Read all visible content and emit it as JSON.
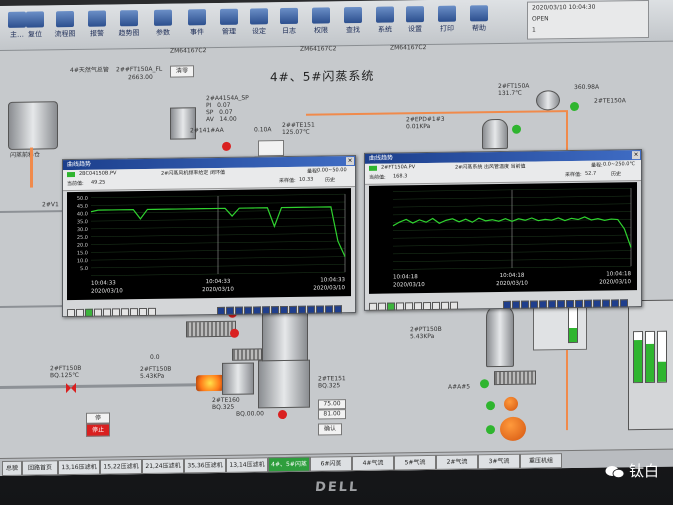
{
  "toolbar": {
    "buttons": [
      "主…",
      "复位",
      "流程图",
      "报警",
      "趋势图",
      "参数",
      "事件",
      "管理",
      "设定",
      "日志",
      "权限",
      "查找",
      "系统",
      "设置",
      "打印",
      "帮助"
    ],
    "status_time": "2020/03/10 10:04:30",
    "status_label": "OPEN",
    "status_line2": "1",
    "sub_tags": [
      "ZM64167C2",
      "ZM64167C2",
      "ZM64167C2"
    ]
  },
  "screen": {
    "title": "4#、5#闪蒸系统",
    "gas_label": "4#天然气总管",
    "gas_tag": "2##FT150A_FL",
    "gas_value": "2663.00",
    "clear_button": "清零",
    "silo_label": "闪蒸前料仓",
    "tag_blocks": [
      {
        "t": "2#A4154A_SP\nPI   0.07\nSP   0.07\nAV   14.00"
      },
      {
        "t": "2#141#AA"
      },
      {
        "t": "0.10A"
      },
      {
        "t": "2##TE151\n125.07℃"
      },
      {
        "t": "2#EPD#1#3\n0.01KPa"
      },
      {
        "t": "2#FT150A\n131.7℃"
      },
      {
        "t": "360.98A"
      },
      {
        "t": "2#TE150A"
      },
      {
        "t": "2#PT150B\n5.43KPa"
      },
      {
        "t": "2#TE151\nBQ.325"
      },
      {
        "t": "2#FT150B\nBQ.125℃"
      },
      {
        "t": "2#FT150B\n5.43KPa"
      },
      {
        "t": "2#TE160\nBQ.325"
      },
      {
        "t": "BQ.00.00"
      },
      {
        "t": "75.00"
      },
      {
        "t": "81.00"
      },
      {
        "t": "0.0"
      },
      {
        "t": "2#V1"
      },
      {
        "t": "A#A#5"
      }
    ],
    "confirm_button": "确认",
    "left_boxes": [
      "停",
      "停止"
    ]
  },
  "trend1": {
    "title": "曲线趋势",
    "tag": "2BC04150B.PV",
    "desc": "2#闪蒸风机频率给定 闭环值",
    "range_label": "量程:",
    "range": "0.00~50.00",
    "cursor_label": "当前值:",
    "cursor": "49.25",
    "period_label": "采样值:",
    "period": "10.33",
    "mode": "历史",
    "times": [
      "10:04:33",
      "10:04:33",
      "10:04:33"
    ],
    "dates": [
      "2020/03/10",
      "2020/03/10",
      "2020/03/10"
    ],
    "ticks": [
      "50.0",
      "45.0",
      "40.0",
      "35.0",
      "30.0",
      "25.0",
      "20.0",
      "15.0",
      "10.0",
      "5.0"
    ]
  },
  "trend2": {
    "title": "曲线趋势",
    "tag": "2#FT150A.PV",
    "desc": "2#闪蒸系统 出风管温度 当前值",
    "range_label": "量程:",
    "range": "0.0~250.0℃",
    "cursor_label": "当前值:",
    "cursor": "168.3",
    "period_label": "采样值:",
    "period": "52.7",
    "mode": "历史",
    "times": [
      "10:04:18",
      "10:04:18",
      "10:04:18"
    ],
    "dates": [
      "2020/03/10",
      "2020/03/10",
      "2020/03/10"
    ]
  },
  "chart_data": [
    {
      "type": "line",
      "series": [
        {
          "values": [
            41,
            42,
            42,
            42,
            42,
            42,
            42,
            36,
            42,
            42,
            42,
            42,
            42,
            42,
            42,
            42,
            42,
            42,
            42,
            42,
            37,
            42,
            42,
            42,
            42,
            42,
            30,
            42,
            42,
            42,
            42,
            42,
            42,
            42,
            42,
            20,
            10
          ]
        }
      ],
      "ylim": [
        0,
        50
      ]
    },
    {
      "type": "line",
      "series": [
        {
          "values": [
            140,
            152,
            160,
            148,
            158,
            150,
            162,
            146,
            155,
            160,
            150,
            158,
            148,
            161,
            152,
            155,
            150,
            158,
            149,
            157,
            152,
            159,
            150,
            154,
            151,
            158,
            149,
            156,
            152,
            160,
            150,
            154,
            148,
            152,
            150,
            120,
            60
          ]
        }
      ],
      "ylim": [
        0,
        250
      ]
    }
  ],
  "tabs": [
    "总貌",
    "回路首页",
    "13,16压滤机",
    "15,22压滤机",
    "21,24压滤机",
    "35,36压滤机",
    "13,14压滤机",
    "4#、5#闪蒸",
    "6#闪蒸",
    "4#气流",
    "5#气流",
    "2#气流",
    "3#气流",
    "重压机组"
  ],
  "watermark": "钛白",
  "brand": "DELL"
}
